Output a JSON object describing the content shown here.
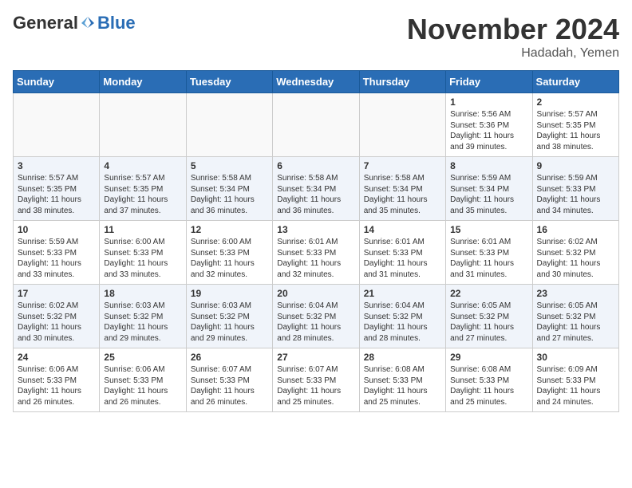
{
  "header": {
    "logo_general": "General",
    "logo_blue": "Blue",
    "month": "November 2024",
    "location": "Hadadah, Yemen"
  },
  "weekdays": [
    "Sunday",
    "Monday",
    "Tuesday",
    "Wednesday",
    "Thursday",
    "Friday",
    "Saturday"
  ],
  "weeks": [
    [
      {
        "day": "",
        "info": ""
      },
      {
        "day": "",
        "info": ""
      },
      {
        "day": "",
        "info": ""
      },
      {
        "day": "",
        "info": ""
      },
      {
        "day": "",
        "info": ""
      },
      {
        "day": "1",
        "info": "Sunrise: 5:56 AM\nSunset: 5:36 PM\nDaylight: 11 hours and 39 minutes."
      },
      {
        "day": "2",
        "info": "Sunrise: 5:57 AM\nSunset: 5:35 PM\nDaylight: 11 hours and 38 minutes."
      }
    ],
    [
      {
        "day": "3",
        "info": "Sunrise: 5:57 AM\nSunset: 5:35 PM\nDaylight: 11 hours and 38 minutes."
      },
      {
        "day": "4",
        "info": "Sunrise: 5:57 AM\nSunset: 5:35 PM\nDaylight: 11 hours and 37 minutes."
      },
      {
        "day": "5",
        "info": "Sunrise: 5:58 AM\nSunset: 5:34 PM\nDaylight: 11 hours and 36 minutes."
      },
      {
        "day": "6",
        "info": "Sunrise: 5:58 AM\nSunset: 5:34 PM\nDaylight: 11 hours and 36 minutes."
      },
      {
        "day": "7",
        "info": "Sunrise: 5:58 AM\nSunset: 5:34 PM\nDaylight: 11 hours and 35 minutes."
      },
      {
        "day": "8",
        "info": "Sunrise: 5:59 AM\nSunset: 5:34 PM\nDaylight: 11 hours and 35 minutes."
      },
      {
        "day": "9",
        "info": "Sunrise: 5:59 AM\nSunset: 5:33 PM\nDaylight: 11 hours and 34 minutes."
      }
    ],
    [
      {
        "day": "10",
        "info": "Sunrise: 5:59 AM\nSunset: 5:33 PM\nDaylight: 11 hours and 33 minutes."
      },
      {
        "day": "11",
        "info": "Sunrise: 6:00 AM\nSunset: 5:33 PM\nDaylight: 11 hours and 33 minutes."
      },
      {
        "day": "12",
        "info": "Sunrise: 6:00 AM\nSunset: 5:33 PM\nDaylight: 11 hours and 32 minutes."
      },
      {
        "day": "13",
        "info": "Sunrise: 6:01 AM\nSunset: 5:33 PM\nDaylight: 11 hours and 32 minutes."
      },
      {
        "day": "14",
        "info": "Sunrise: 6:01 AM\nSunset: 5:33 PM\nDaylight: 11 hours and 31 minutes."
      },
      {
        "day": "15",
        "info": "Sunrise: 6:01 AM\nSunset: 5:33 PM\nDaylight: 11 hours and 31 minutes."
      },
      {
        "day": "16",
        "info": "Sunrise: 6:02 AM\nSunset: 5:32 PM\nDaylight: 11 hours and 30 minutes."
      }
    ],
    [
      {
        "day": "17",
        "info": "Sunrise: 6:02 AM\nSunset: 5:32 PM\nDaylight: 11 hours and 30 minutes."
      },
      {
        "day": "18",
        "info": "Sunrise: 6:03 AM\nSunset: 5:32 PM\nDaylight: 11 hours and 29 minutes."
      },
      {
        "day": "19",
        "info": "Sunrise: 6:03 AM\nSunset: 5:32 PM\nDaylight: 11 hours and 29 minutes."
      },
      {
        "day": "20",
        "info": "Sunrise: 6:04 AM\nSunset: 5:32 PM\nDaylight: 11 hours and 28 minutes."
      },
      {
        "day": "21",
        "info": "Sunrise: 6:04 AM\nSunset: 5:32 PM\nDaylight: 11 hours and 28 minutes."
      },
      {
        "day": "22",
        "info": "Sunrise: 6:05 AM\nSunset: 5:32 PM\nDaylight: 11 hours and 27 minutes."
      },
      {
        "day": "23",
        "info": "Sunrise: 6:05 AM\nSunset: 5:32 PM\nDaylight: 11 hours and 27 minutes."
      }
    ],
    [
      {
        "day": "24",
        "info": "Sunrise: 6:06 AM\nSunset: 5:33 PM\nDaylight: 11 hours and 26 minutes."
      },
      {
        "day": "25",
        "info": "Sunrise: 6:06 AM\nSunset: 5:33 PM\nDaylight: 11 hours and 26 minutes."
      },
      {
        "day": "26",
        "info": "Sunrise: 6:07 AM\nSunset: 5:33 PM\nDaylight: 11 hours and 26 minutes."
      },
      {
        "day": "27",
        "info": "Sunrise: 6:07 AM\nSunset: 5:33 PM\nDaylight: 11 hours and 25 minutes."
      },
      {
        "day": "28",
        "info": "Sunrise: 6:08 AM\nSunset: 5:33 PM\nDaylight: 11 hours and 25 minutes."
      },
      {
        "day": "29",
        "info": "Sunrise: 6:08 AM\nSunset: 5:33 PM\nDaylight: 11 hours and 25 minutes."
      },
      {
        "day": "30",
        "info": "Sunrise: 6:09 AM\nSunset: 5:33 PM\nDaylight: 11 hours and 24 minutes."
      }
    ]
  ]
}
